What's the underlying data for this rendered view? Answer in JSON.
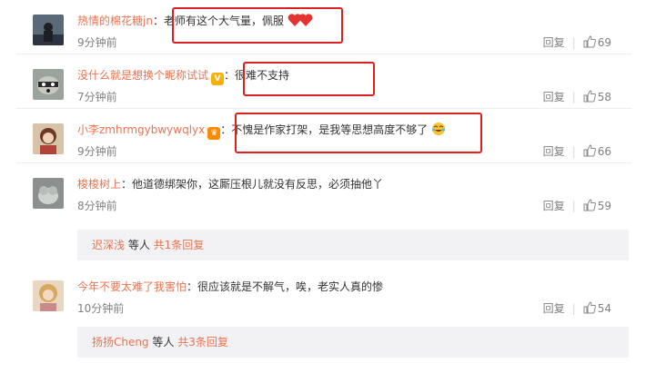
{
  "comments": [
    {
      "username": "热情的棉花糖jn",
      "text": "：老师有这个大气量，佩服",
      "time": "9分钟前",
      "reply": "回复",
      "likes": "69",
      "emoji": "heart-pair"
    },
    {
      "username": "没什么就是想换个昵称试试",
      "text": "：很难不支持",
      "time": "7分钟前",
      "reply": "回复",
      "likes": "58",
      "badge": "V"
    },
    {
      "username": "小李zmhrmgybwywqlyx",
      "text": "：不愧是作家打架，是我等思想高度不够了",
      "time": "9分钟前",
      "reply": "回复",
      "likes": "66",
      "badge": "fan",
      "emoji": "laugh-cry"
    },
    {
      "username": "梭梭树上",
      "text": "：他道德绑架你，这厮压根儿就没有反思，必须抽他丫",
      "time": "8分钟前",
      "reply": "回复",
      "likes": "59"
    },
    {
      "username": "今年不要太难了我害怕",
      "text": "：很应该就是不解气，唉，老实人真的惨",
      "time": "10分钟前",
      "reply": "回复",
      "likes": "54"
    }
  ],
  "subreplies": [
    {
      "who": "迟深浅",
      "middle": " 等人 ",
      "more": "共1条回复"
    },
    {
      "who": "扬扬Cheng",
      "middle": " 等人 ",
      "more": "共3条回复"
    }
  ],
  "colors": {
    "username": "#eb7350",
    "highlight": "#e02020",
    "muted": "#808080"
  }
}
